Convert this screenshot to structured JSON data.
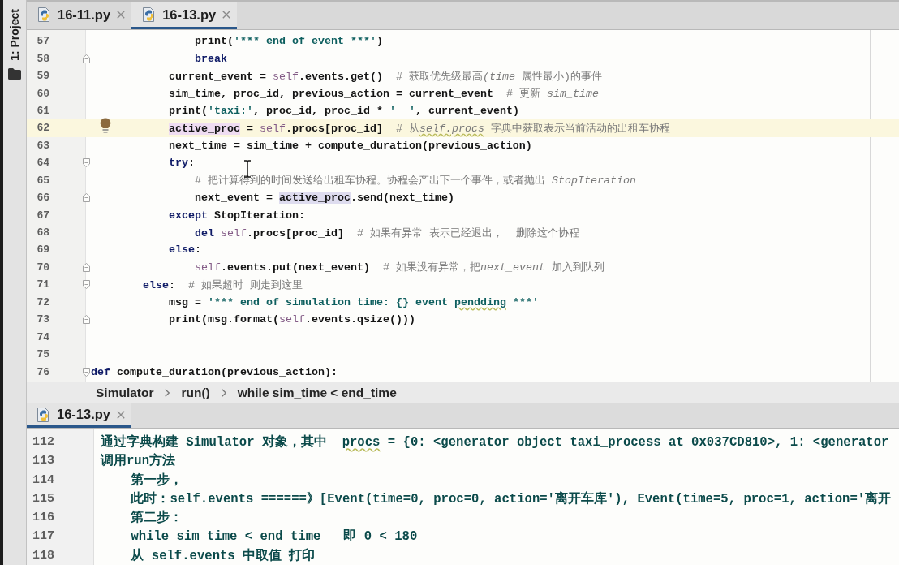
{
  "tool_window_bar": {
    "label": "1: Project"
  },
  "editor": {
    "tabs": [
      {
        "label": "16-11.py",
        "selected": false
      },
      {
        "label": "16-13.py",
        "selected": true
      }
    ],
    "lines": [
      {
        "number": "57",
        "current": false,
        "fold_start": false,
        "fold_end": false,
        "tokens": [
          {
            "text": "                print(",
            "kind": "plain"
          },
          {
            "text": "'*** end of event ***'",
            "kind": "string"
          },
          {
            "text": ")",
            "kind": "plain"
          }
        ]
      },
      {
        "number": "58",
        "current": false,
        "fold_start": false,
        "fold_end": true,
        "tokens": [
          {
            "text": "                break",
            "kind": "keyword"
          }
        ]
      },
      {
        "number": "59",
        "current": false,
        "fold_start": false,
        "fold_end": false,
        "tokens": [
          {
            "text": "            current_event = ",
            "kind": "plain"
          },
          {
            "text": "self",
            "kind": "self"
          },
          {
            "text": ".events.get()",
            "kind": "plain"
          },
          {
            "text": "  # 获取优先级最高",
            "kind": "comment"
          },
          {
            "text": "(time",
            "kind": "comment_em"
          },
          {
            "text": " 属性最小)的事件",
            "kind": "comment"
          }
        ]
      },
      {
        "number": "60",
        "current": false,
        "fold_start": false,
        "fold_end": false,
        "tokens": [
          {
            "text": "            sim_time, proc_id, previous_action = current_event",
            "kind": "plain"
          },
          {
            "text": "  # 更新 ",
            "kind": "comment"
          },
          {
            "text": "sim_time",
            "kind": "comment_em"
          }
        ]
      },
      {
        "number": "61",
        "current": false,
        "fold_start": false,
        "fold_end": false,
        "tokens": [
          {
            "text": "            print(",
            "kind": "plain"
          },
          {
            "text": "'taxi:'",
            "kind": "string"
          },
          {
            "text": ", proc_id, proc_id * ",
            "kind": "plain"
          },
          {
            "text": "'  '",
            "kind": "string"
          },
          {
            "text": ", current_event)",
            "kind": "plain"
          }
        ]
      },
      {
        "number": "62",
        "current": true,
        "fold_start": false,
        "fold_end": false,
        "tokens": [
          {
            "text": "            active_proc",
            "kind": "ref_write"
          },
          {
            "text": " = ",
            "kind": "plain"
          },
          {
            "text": "self",
            "kind": "self"
          },
          {
            "text": ".procs[proc_id]",
            "kind": "plain"
          },
          {
            "text": "  # 从",
            "kind": "comment"
          },
          {
            "text": "self.procs",
            "kind": "comment_em_typo"
          },
          {
            "text": " 字典中获取表示当前活动的出租车协程",
            "kind": "comment"
          }
        ]
      },
      {
        "number": "63",
        "current": false,
        "fold_start": false,
        "fold_end": false,
        "tokens": [
          {
            "text": "            next_time = sim_time + compute_duration(previous_action)",
            "kind": "plain"
          }
        ]
      },
      {
        "number": "64",
        "current": false,
        "fold_start": true,
        "fold_end": false,
        "tokens": [
          {
            "text": "            try",
            "kind": "keyword"
          },
          {
            "text": ":",
            "kind": "plain"
          }
        ]
      },
      {
        "number": "65",
        "current": false,
        "fold_start": false,
        "fold_end": false,
        "tokens": [
          {
            "text": "                # 把计算得到的时间发送给出租车协程。协程会产出下一个事件，或者抛出 ",
            "kind": "comment"
          },
          {
            "text": "StopIteration",
            "kind": "comment_em"
          }
        ]
      },
      {
        "number": "66",
        "current": false,
        "fold_start": false,
        "fold_end": true,
        "tokens": [
          {
            "text": "                next_event = ",
            "kind": "plain"
          },
          {
            "text": "active_proc",
            "kind": "ref_read"
          },
          {
            "text": ".send(next_time)",
            "kind": "plain"
          }
        ]
      },
      {
        "number": "67",
        "current": false,
        "fold_start": false,
        "fold_end": false,
        "tokens": [
          {
            "text": "            except",
            "kind": "keyword"
          },
          {
            "text": " StopIteration:",
            "kind": "plain"
          }
        ]
      },
      {
        "number": "68",
        "current": false,
        "fold_start": false,
        "fold_end": false,
        "tokens": [
          {
            "text": "                del ",
            "kind": "keyword"
          },
          {
            "text": "self",
            "kind": "self"
          },
          {
            "text": ".procs[proc_id]",
            "kind": "plain"
          },
          {
            "text": "  # 如果有异常 表示已经退出，  删除这个协程",
            "kind": "comment"
          }
        ]
      },
      {
        "number": "69",
        "current": false,
        "fold_start": false,
        "fold_end": false,
        "tokens": [
          {
            "text": "            else",
            "kind": "keyword"
          },
          {
            "text": ":",
            "kind": "plain"
          }
        ]
      },
      {
        "number": "70",
        "current": false,
        "fold_start": false,
        "fold_end": true,
        "tokens": [
          {
            "text": "                self",
            "kind": "self"
          },
          {
            "text": ".events.put(next_event)",
            "kind": "plain"
          },
          {
            "text": "  # 如果没有异常，把",
            "kind": "comment"
          },
          {
            "text": "next_event",
            "kind": "comment_em"
          },
          {
            "text": " 加入到队列",
            "kind": "comment"
          }
        ]
      },
      {
        "number": "71",
        "current": false,
        "fold_start": true,
        "fold_end": false,
        "tokens": [
          {
            "text": "        else",
            "kind": "keyword"
          },
          {
            "text": ":",
            "kind": "plain"
          },
          {
            "text": "  # 如果超时 则走到这里",
            "kind": "comment"
          }
        ]
      },
      {
        "number": "72",
        "current": false,
        "fold_start": false,
        "fold_end": false,
        "tokens": [
          {
            "text": "            msg = ",
            "kind": "plain"
          },
          {
            "text": "'*** end of simulation time: {} event ",
            "kind": "string"
          },
          {
            "text": "pendding",
            "kind": "string_typo"
          },
          {
            "text": " ***'",
            "kind": "string"
          }
        ]
      },
      {
        "number": "73",
        "current": false,
        "fold_start": false,
        "fold_end": true,
        "tokens": [
          {
            "text": "            print(msg.format(",
            "kind": "plain"
          },
          {
            "text": "self",
            "kind": "self"
          },
          {
            "text": ".events.qsize()))",
            "kind": "plain"
          }
        ]
      },
      {
        "number": "74",
        "current": false,
        "fold_start": false,
        "fold_end": false
      },
      {
        "number": "75",
        "current": false,
        "fold_start": false,
        "fold_end": false
      },
      {
        "number": "76",
        "current": false,
        "fold_start": true,
        "fold_end": false,
        "tokens": [
          {
            "text": "def",
            "kind": "keyword"
          },
          {
            "text": " compute_duration(previous_action):",
            "kind": "plain"
          }
        ]
      }
    ],
    "breadcrumbs": [
      "Simulator",
      "run()",
      "while sim_time < end_time"
    ]
  },
  "bottom_panel": {
    "tabs": [
      {
        "label": "16-13.py",
        "selected": true
      }
    ],
    "lines": [
      {
        "number": "112",
        "tokens": [
          {
            "text": "通过字典构建 Simulator 对象，其中  ",
            "kind": "doc"
          },
          {
            "text": "procs",
            "kind": "doc_typo"
          },
          {
            "text": " = {0: <generator object taxi_process at 0x037CD810>, 1: <generator",
            "kind": "doc"
          }
        ]
      },
      {
        "number": "113",
        "tokens": [
          {
            "text": "调用run方法",
            "kind": "doc"
          }
        ]
      },
      {
        "number": "114",
        "tokens": [
          {
            "text": "    第一步，",
            "kind": "doc"
          }
        ]
      },
      {
        "number": "115",
        "tokens": [
          {
            "text": "    此时：self.events ======》[Event(time=0, proc=0, action='离开车库'), Event(time=5, proc=1, action='离开",
            "kind": "doc"
          }
        ]
      },
      {
        "number": "116",
        "tokens": [
          {
            "text": "    第二步：",
            "kind": "doc"
          }
        ]
      },
      {
        "number": "117",
        "tokens": [
          {
            "text": "    while sim_time < end_time   即 0 < 180",
            "kind": "doc"
          }
        ]
      },
      {
        "number": "118",
        "tokens": [
          {
            "text": "    从 self.events 中取值 打印",
            "kind": "doc"
          }
        ]
      }
    ]
  }
}
